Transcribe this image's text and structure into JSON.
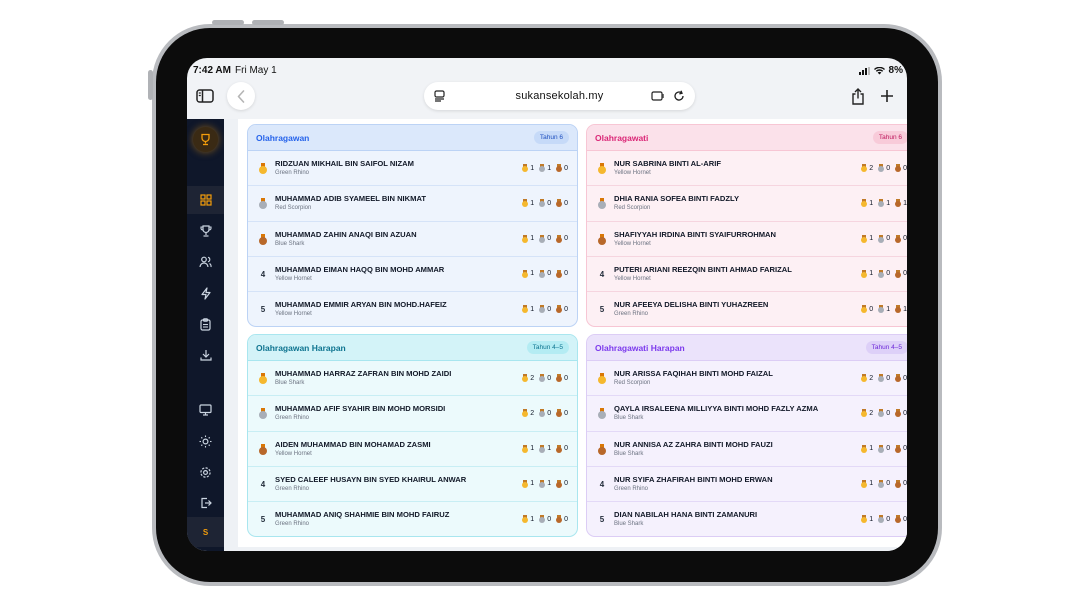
{
  "status_bar": {
    "time": "7:42 AM",
    "date": "Fri May 1",
    "battery": "8%"
  },
  "browser": {
    "url": "sukansekolah.my"
  },
  "sidebar": {
    "avatar_initial": "S",
    "items": [
      {
        "icon": "dashboard-icon",
        "active": true
      },
      {
        "icon": "trophy-icon"
      },
      {
        "icon": "users-icon"
      },
      {
        "icon": "bolt-icon"
      },
      {
        "icon": "clipboard-icon"
      },
      {
        "icon": "download-icon"
      },
      {
        "icon": "monitor-icon"
      },
      {
        "icon": "sun-icon"
      },
      {
        "icon": "gear-icon"
      },
      {
        "icon": "logout-icon"
      }
    ]
  },
  "colors": {
    "gold": "#f5b82e",
    "silver": "#a8aeb7",
    "bronze": "#b8682a",
    "accent": "#f59e0b",
    "sidebar_bg": "#0f172a"
  },
  "cards": [
    {
      "title": "Olahragawan",
      "badge": "Tahun 6",
      "theme": "blue",
      "rows": [
        {
          "rank": "1",
          "name": "RIDZUAN MIKHAIL BIN SAIFOL NIZAM",
          "team": "Green Rhino",
          "gold": "1",
          "silver": "1",
          "bronze": "0"
        },
        {
          "rank": "2",
          "name": "MUHAMMAD ADIB SYAMEEL BIN NIKMAT",
          "team": "Red Scorpion",
          "gold": "1",
          "silver": "0",
          "bronze": "0"
        },
        {
          "rank": "3",
          "name": "MUHAMMAD ZAHIN ANAQI BIN AZUAN",
          "team": "Blue Shark",
          "gold": "1",
          "silver": "0",
          "bronze": "0"
        },
        {
          "rank": "4",
          "name": "MUHAMMAD EIMAN HAQQ BIN MOHD AMMAR",
          "team": "Yellow Hornet",
          "gold": "1",
          "silver": "0",
          "bronze": "0"
        },
        {
          "rank": "5",
          "name": "MUHAMMAD EMMIR ARYAN BIN MOHD.HAFEIZ",
          "team": "Yellow Hornet",
          "gold": "1",
          "silver": "0",
          "bronze": "0"
        }
      ]
    },
    {
      "title": "Olahragawati",
      "badge": "Tahun 6",
      "theme": "pink",
      "rows": [
        {
          "rank": "1",
          "name": "NUR SABRINA BINTI AL-ARIF",
          "team": "Yellow Hornet",
          "gold": "2",
          "silver": "0",
          "bronze": "0"
        },
        {
          "rank": "2",
          "name": "DHIA RANIA SOFEA BINTI FADZLY",
          "team": "Red Scorpion",
          "gold": "1",
          "silver": "1",
          "bronze": "1"
        },
        {
          "rank": "3",
          "name": "SHAFIYYAH IRDINA BINTI SYAIFURROHMAN",
          "team": "Yellow Hornet",
          "gold": "1",
          "silver": "0",
          "bronze": "0"
        },
        {
          "rank": "4",
          "name": "PUTERI ARIANI REEZQIN BINTI AHMAD FARIZAL",
          "team": "Yellow Hornet",
          "gold": "1",
          "silver": "0",
          "bronze": "0"
        },
        {
          "rank": "5",
          "name": "NUR AFEEYA DELISHA BINTI YUHAZREEN",
          "team": "Green Rhino",
          "gold": "0",
          "silver": "1",
          "bronze": "1"
        }
      ]
    },
    {
      "title": "Olahragawan Harapan",
      "badge": "Tahun 4–5",
      "theme": "cyan",
      "rows": [
        {
          "rank": "1",
          "name": "MUHAMMAD HARRAZ ZAFRAN BIN MOHD ZAIDI",
          "team": "Blue Shark",
          "gold": "2",
          "silver": "0",
          "bronze": "0"
        },
        {
          "rank": "2",
          "name": "MUHAMMAD AFIF SYAHIR BIN MOHD MORSIDI",
          "team": "Green Rhino",
          "gold": "2",
          "silver": "0",
          "bronze": "0"
        },
        {
          "rank": "3",
          "name": "AIDEN MUHAMMAD BIN MOHAMAD ZASMI",
          "team": "Yellow Hornet",
          "gold": "1",
          "silver": "1",
          "bronze": "0"
        },
        {
          "rank": "4",
          "name": "SYED CALEEF HUSAYN BIN SYED KHAIRUL ANWAR",
          "team": "Green Rhino",
          "gold": "1",
          "silver": "1",
          "bronze": "0"
        },
        {
          "rank": "5",
          "name": "MUHAMMAD ANIQ SHAHMIE BIN MOHD FAIRUZ",
          "team": "Green Rhino",
          "gold": "1",
          "silver": "0",
          "bronze": "0"
        }
      ]
    },
    {
      "title": "Olahragawati Harapan",
      "badge": "Tahun 4–5",
      "theme": "purple",
      "rows": [
        {
          "rank": "1",
          "name": "NUR ARISSA FAQIHAH BINTI MOHD FAIZAL",
          "team": "Red Scorpion",
          "gold": "2",
          "silver": "0",
          "bronze": "0"
        },
        {
          "rank": "2",
          "name": "QAYLA IRSALEENA MILLIYYA BINTI MOHD FAZLY AZMA",
          "team": "Blue Shark",
          "gold": "2",
          "silver": "0",
          "bronze": "0"
        },
        {
          "rank": "3",
          "name": "NUR ANNISA AZ ZAHRA BINTI MOHD FAUZI",
          "team": "Blue Shark",
          "gold": "1",
          "silver": "0",
          "bronze": "0"
        },
        {
          "rank": "4",
          "name": "NUR SYIFA ZHAFIRAH BINTI MOHD ERWAN",
          "team": "Green Rhino",
          "gold": "1",
          "silver": "0",
          "bronze": "0"
        },
        {
          "rank": "5",
          "name": "DIAN NABILAH HANA BINTI ZAMANURI",
          "team": "Blue Shark",
          "gold": "1",
          "silver": "0",
          "bronze": "0"
        }
      ]
    }
  ]
}
